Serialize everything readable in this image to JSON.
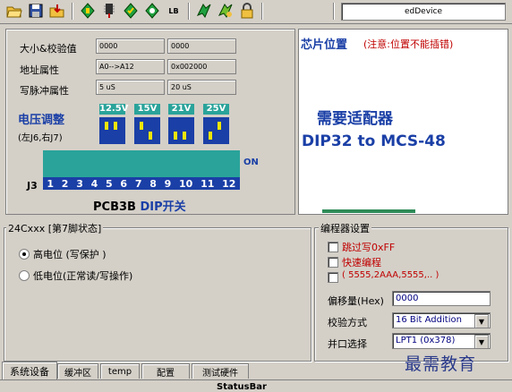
{
  "toolbar": {
    "icons": [
      "open-icon",
      "save-icon",
      "load-icon",
      "read-icon",
      "program-icon",
      "verify-icon",
      "blank-check-icon",
      "lb-icon",
      "erase-icon",
      "auto-icon",
      "lock-icon"
    ],
    "lb_label": "LB",
    "device_box": "edDevice"
  },
  "left": {
    "rows": [
      {
        "label": "大小&校验值",
        "value1": "0000",
        "value2": "0000"
      },
      {
        "label": "地址属性",
        "value1": "A0-->A12",
        "value2": "0x002000"
      },
      {
        "label": "写脉冲属性",
        "value1": "5 uS",
        "value2": "20 uS"
      }
    ],
    "voltage_title": "电压调整",
    "voltage_sub": "(左J6,右J7)",
    "voltages": [
      "12.5V",
      "15V",
      "21V",
      "25V"
    ],
    "dip_on": "ON",
    "j3": "J3",
    "dip_numbers": [
      "1",
      "2",
      "3",
      "4",
      "5",
      "6",
      "7",
      "8",
      "9",
      "10",
      "11",
      "12"
    ],
    "pcb_title": "PCB3B",
    "pcb_dip": "DIP",
    "pcb_switch": "开关"
  },
  "right": {
    "title": "芯片位置",
    "note": "(注意:位置不能插错)",
    "adapter_l1": "需要适配器",
    "adapter_l2": "DIP32 to MCS-48"
  },
  "pin7": {
    "title": "24Cxxx [第7脚状态]",
    "opt_high": "高电位 (写保护 )",
    "opt_low": "低电位(正常读/写操作)"
  },
  "prog": {
    "title": "编程器设置",
    "opt_skip": "跳过写0xFF",
    "opt_fast": "快速编程",
    "opt_seq": "( 5555,2AAA,5555,.. )",
    "offset_label": "偏移量(Hex)",
    "offset_value": "0000",
    "checksum_label": "校验方式",
    "checksum_value": "16 Bit Addition",
    "port_label": "并口选择",
    "port_value": "LPT1 (0x378)"
  },
  "watermark": "最需教育",
  "tabs": [
    "系统设备",
    "缓冲区",
    "temp",
    "配置",
    "测试硬件"
  ],
  "status": "StatusBar"
}
